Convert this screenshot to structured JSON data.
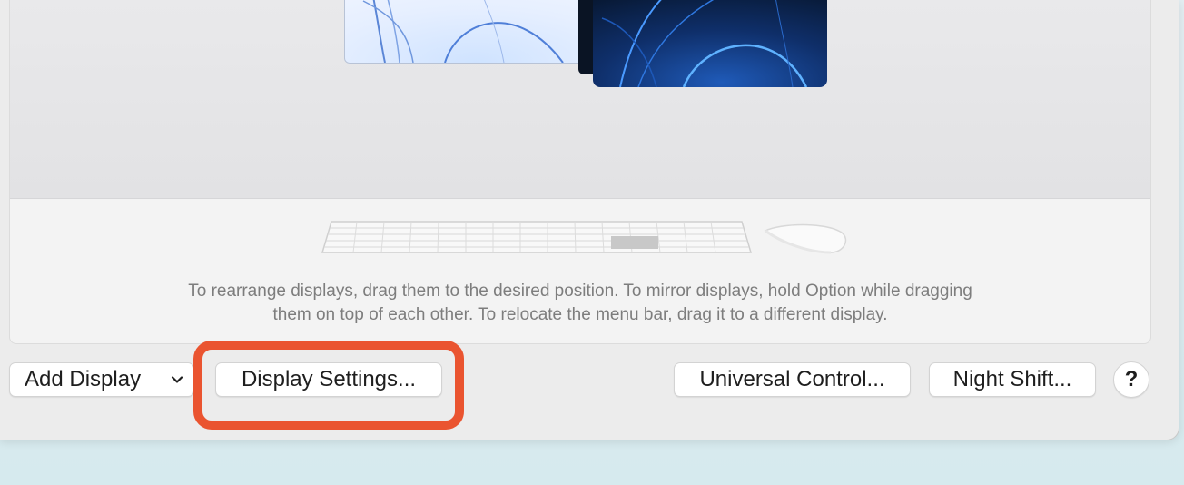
{
  "instructions": {
    "line1": "To rearrange displays, drag them to the desired position. To mirror displays, hold Option while dragging",
    "line2": "them on top of each other. To relocate the menu bar, drag it to a different display."
  },
  "buttons": {
    "add_display": "Add Display",
    "display_settings": "Display Settings...",
    "universal_control": "Universal Control...",
    "night_shift": "Night Shift...",
    "help": "?"
  },
  "icons": {
    "add_display_dropdown": "chevron-down-icon",
    "keyboard": "keyboard-icon",
    "mouse": "mouse-icon"
  },
  "colors": {
    "highlight": "#ea5430"
  }
}
